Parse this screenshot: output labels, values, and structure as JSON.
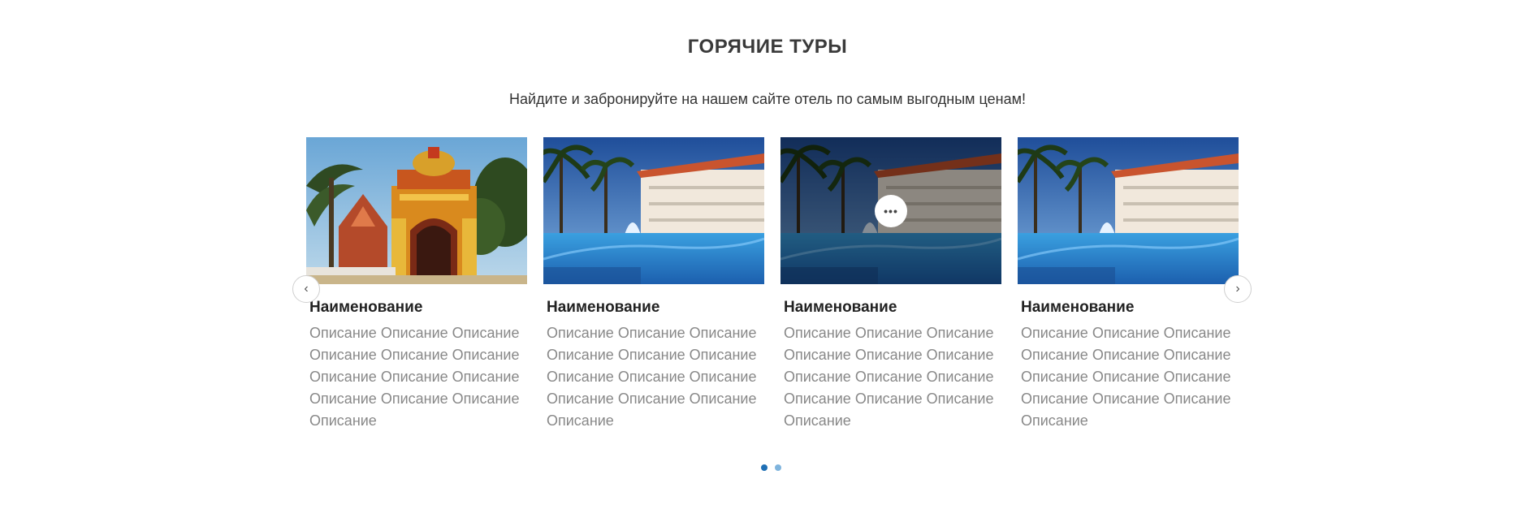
{
  "section": {
    "title": "ГОРЯЧИЕ ТУРЫ",
    "subtitle": "Найдите и забронируйте на нашем сайте отель по самым выгодным ценам!"
  },
  "cards": [
    {
      "name": "Наименование",
      "description": "Описание Описание Описание Описание Описание Описание Описание Описание Описание Описание Описание Описание Описание",
      "image": "temple-photo"
    },
    {
      "name": "Наименование",
      "description": "Описание Описание Описание Описание Описание Описание Описание Описание Описание Описание Описание Описание Описание",
      "image": "resort-pool-photo"
    },
    {
      "name": "Наименование",
      "description": "Описание Описание Описание Описание Описание Описание Описание Описание Описание Описание Описание Описание Описание",
      "image": "resort-pool-photo",
      "hovered": true,
      "more_icon": "•••"
    },
    {
      "name": "Наименование",
      "description": "Описание Описание Описание Описание Описание Описание Описание Описание Описание Описание Описание Описание Описание",
      "image": "resort-pool-photo"
    }
  ],
  "navigation": {
    "prev_icon": "‹",
    "next_icon": "›"
  },
  "pagination": {
    "active_color": "#1f6fb5",
    "inactive_color": "#7fb4dd",
    "total": 2,
    "active": 1
  }
}
